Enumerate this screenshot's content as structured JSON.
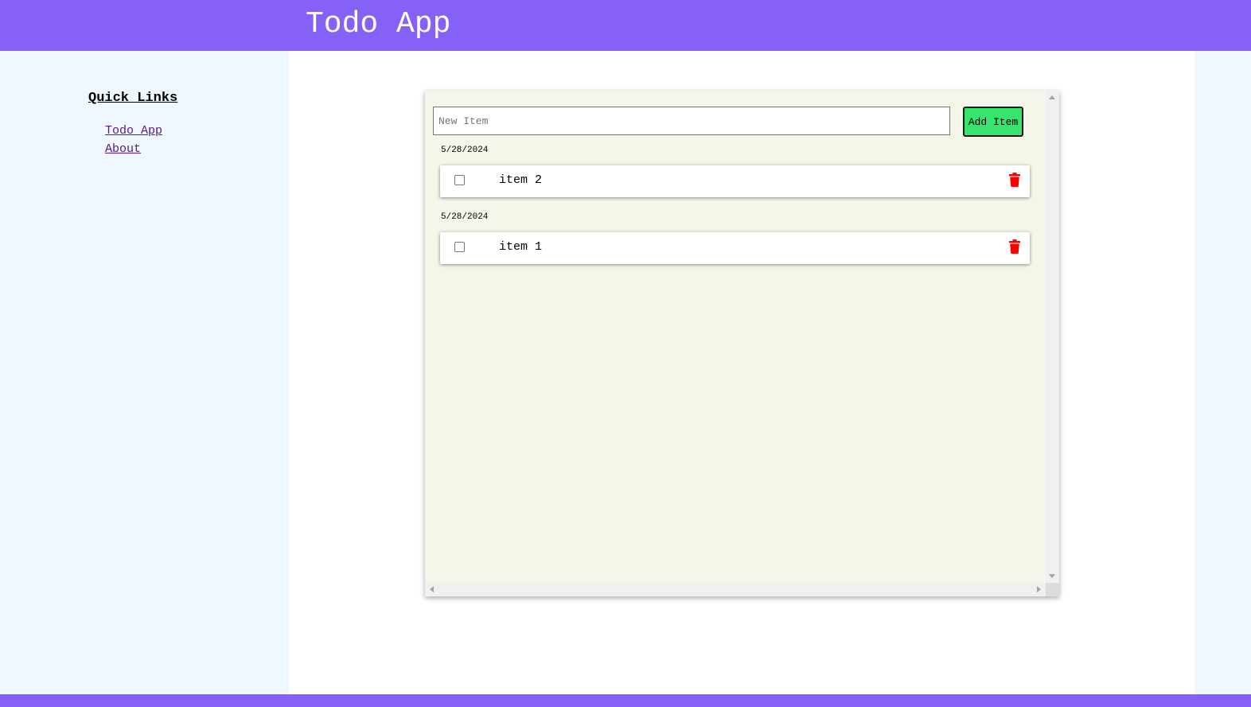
{
  "header": {
    "title": "Todo App",
    "bg_color": "#8661f7"
  },
  "sidebar": {
    "title": "Quick Links",
    "links": [
      {
        "label": "Todo App"
      },
      {
        "label": "About"
      }
    ]
  },
  "todo": {
    "input_placeholder": "New Item",
    "input_value": "",
    "add_button_label": "Add Item",
    "add_button_color": "#36e66c",
    "delete_icon_color": "#ff0000",
    "items": [
      {
        "date": "5/28/2024",
        "text": "item 2",
        "checked": false,
        "delete_icon": "trash-icon"
      },
      {
        "date": "5/28/2024",
        "text": "item 1",
        "checked": false,
        "delete_icon": "trash-icon"
      }
    ]
  }
}
